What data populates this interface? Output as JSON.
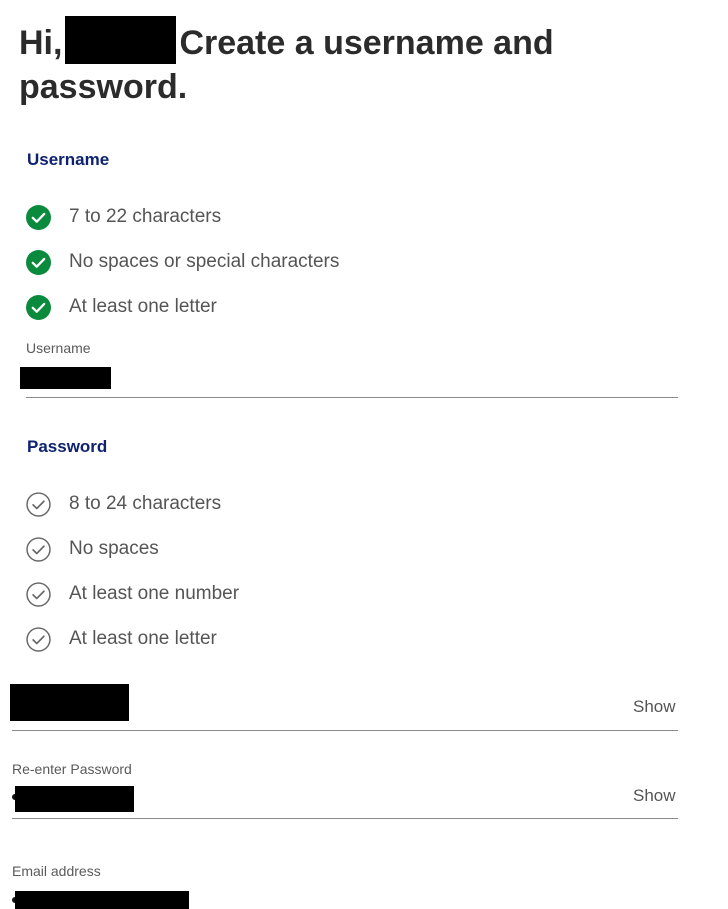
{
  "header": {
    "greeting": "Hi,",
    "title_rest": "Create a username and password."
  },
  "username_section": {
    "heading": "Username",
    "requirements": [
      {
        "text": "7 to 22 characters",
        "status": "met",
        "icon": "check-circle-filled-icon"
      },
      {
        "text": "No spaces or special characters",
        "status": "met",
        "icon": "check-circle-filled-icon"
      },
      {
        "text": "At least one letter",
        "status": "met",
        "icon": "check-circle-filled-icon"
      }
    ],
    "field_label": "Username"
  },
  "password_section": {
    "heading": "Password",
    "requirements": [
      {
        "text": "8 to 24 characters",
        "status": "unmet",
        "icon": "check-circle-outline-icon"
      },
      {
        "text": "No spaces",
        "status": "unmet",
        "icon": "check-circle-outline-icon"
      },
      {
        "text": "At least one number",
        "status": "unmet",
        "icon": "check-circle-outline-icon"
      },
      {
        "text": "At least one letter",
        "status": "unmet",
        "icon": "check-circle-outline-icon"
      }
    ],
    "show_label": "Show"
  },
  "reenter_password": {
    "label": "Re-enter Password",
    "show_label": "Show"
  },
  "email": {
    "label": "Email address"
  },
  "colors": {
    "heading_text": "#2b2b2b",
    "section_heading": "#0d2370",
    "check_met": "#0a8a3c",
    "check_unmet": "#666666",
    "divider": "#8c8c8c"
  }
}
